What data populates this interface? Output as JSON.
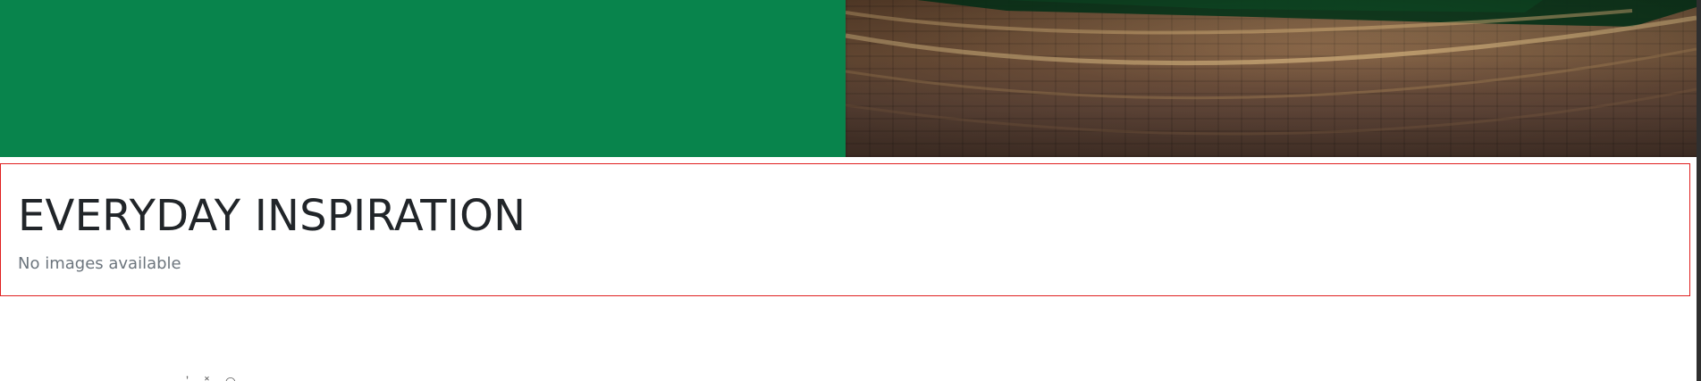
{
  "hero": {
    "colors": {
      "green_panel": "#08844c"
    },
    "image_name": "lobby-floor-photo"
  },
  "section": {
    "title": "EVERYDAY INSPIRATION",
    "subtitle": "No images available",
    "colors": {
      "border": "#e02020",
      "title": "#212529",
      "subtitle": "#6c757d"
    }
  },
  "cutoff_icons": [
    "toolbar-icon-1",
    "toolbar-icon-2",
    "toolbar-icon-3"
  ]
}
